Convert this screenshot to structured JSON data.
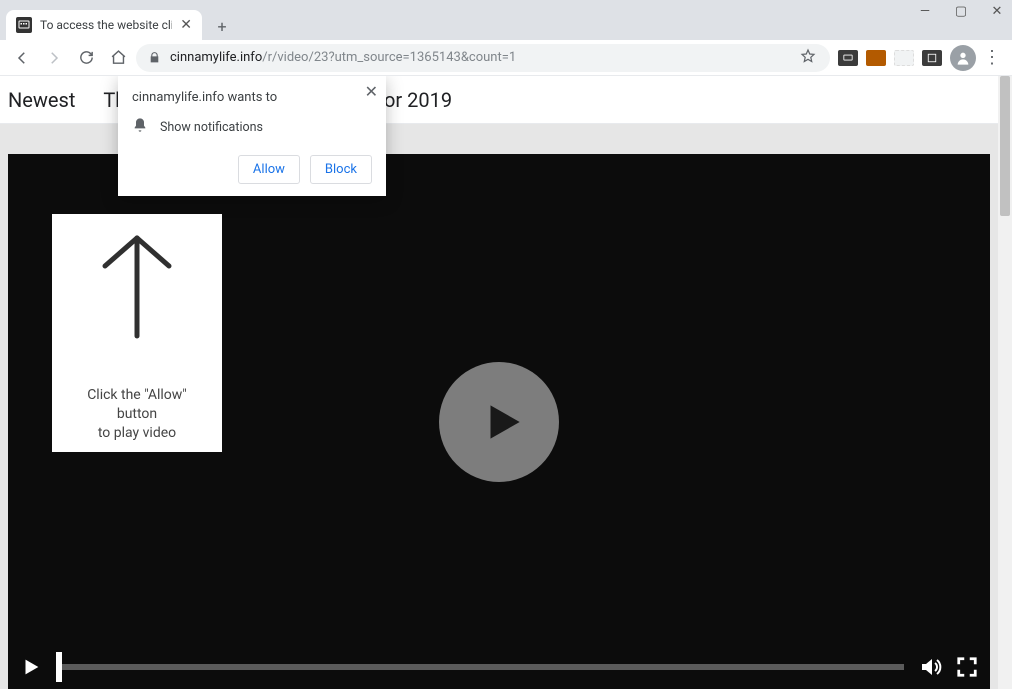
{
  "window": {
    "minimize_glyph": "—",
    "maximize_glyph": "▢",
    "close_glyph": "✕"
  },
  "tab": {
    "title": "To access the website click the \"/",
    "close_glyph": "✕",
    "newtab_glyph": "+"
  },
  "nav": {
    "url_host": "cinnamylife.info",
    "url_rest": "/r/video/23?utm_source=1365143&count=1"
  },
  "page_header": {
    "left": "Newest",
    "mid_fragment": "The",
    "right_fragment": "or 2019"
  },
  "instruction": {
    "line1": "Click the \"Allow\" button",
    "line2": "to play video"
  },
  "notification": {
    "wants_to": "cinnamylife.info wants to",
    "permission_label": "Show notifications",
    "allow": "Allow",
    "block": "Block",
    "close_glyph": "✕"
  }
}
